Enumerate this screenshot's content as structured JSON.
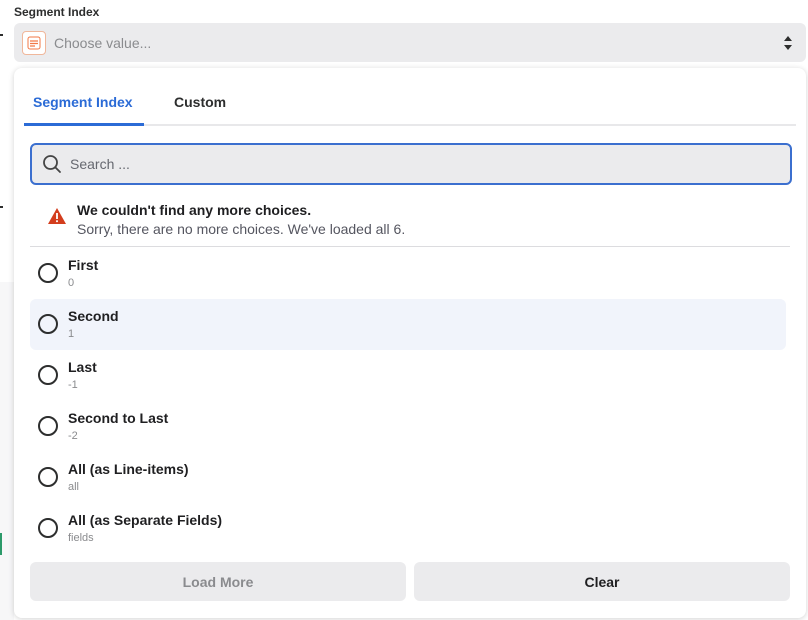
{
  "field": {
    "label": "Segment Index",
    "placeholder": "Choose value..."
  },
  "tabs": [
    {
      "label": "Segment Index",
      "active": true
    },
    {
      "label": "Custom",
      "active": false
    }
  ],
  "search": {
    "placeholder": "Search ..."
  },
  "notice": {
    "title": "We couldn't find any more choices.",
    "text": "Sorry, there are no more choices. We've loaded all 6."
  },
  "options": [
    {
      "label": "First",
      "value": "0"
    },
    {
      "label": "Second",
      "value": "1"
    },
    {
      "label": "Last",
      "value": "-1"
    },
    {
      "label": "Second to Last",
      "value": "-2"
    },
    {
      "label": "All (as Line-items)",
      "value": "all"
    },
    {
      "label": "All (as Separate Fields)",
      "value": "fields"
    }
  ],
  "buttons": {
    "load_more": "Load More",
    "clear": "Clear"
  },
  "colors": {
    "accent": "#2b6bd6",
    "warning": "#d33d1d",
    "hover_row": "#f1f4fb"
  },
  "icons": {
    "app": "formatter-app-icon",
    "sort": "sort-arrows-icon",
    "search": "search-icon",
    "warning": "warning-triangle-icon"
  }
}
